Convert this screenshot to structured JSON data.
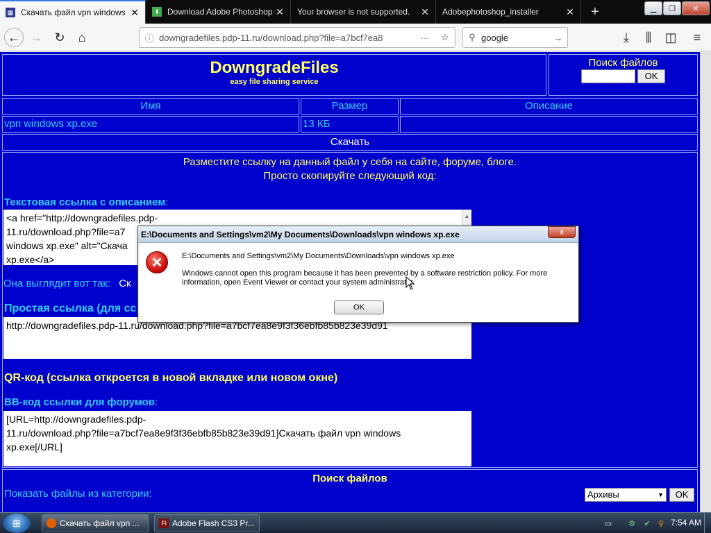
{
  "browser": {
    "tabs": [
      {
        "title": "Скачать файл vpn windows",
        "active": true,
        "icon": "site-favicon"
      },
      {
        "title": "Download Adobe Photoshop",
        "active": false,
        "icon": "green-download-favicon"
      },
      {
        "title": "Your browser is not supported.",
        "active": false,
        "icon": ""
      },
      {
        "title": "Adobephotoshop_installer",
        "active": false,
        "icon": ""
      }
    ],
    "new_tab": "+",
    "url": "downgradefiles.pdp-11.ru/download.php?file=a7bcf7ea8",
    "search_value": "google"
  },
  "site": {
    "logo_title": "DowngradeFiles",
    "logo_subtitle": "easy file sharing service",
    "search_label": "Поиск файлов",
    "search_ok": "OK",
    "table_headers": [
      "Имя",
      "Размер",
      "Описание"
    ],
    "file_name": "vpn windows xp.exe",
    "file_size": "13 КБ",
    "file_desc": "",
    "download_label": "Скачать",
    "share_line1": "Разместите ссылку на данный файл у себя на сайте, форуме, блоге.",
    "share_line2": "Просто скопируйте следующий код:",
    "text_link_label": "Текстовая ссылка с описанием",
    "text_link_colon": ":",
    "text_link_code": "<a href=\"http://downgradefiles.pdp-11.ru/download.php?file=a7... windows xp.exe\" alt=\"Скача... xp.exe</a>",
    "text_link_line1": "<a href=\"http://downgradefiles.pdp-",
    "text_link_line2": "11.ru/download.php?file=a7",
    "text_link_line3": "windows xp.exe\" alt=\"Скача",
    "text_link_line4": "xp.exe</a>",
    "preview_label": "Она выглядит вот так:",
    "preview_value": "Ск",
    "simple_link_label": "Простая ссылка (для сс",
    "simple_link_code": "http://downgradefiles.pdp-11.ru/download.php?file=a7bcf7ea8e9f3f36ebfb85b823e39d91",
    "qr_label": "QR-код (ссылка откроется в новой вкладке или новом окне)",
    "bb_label": "BB-код ссылки для форумов",
    "bb_colon": ":",
    "bb_line1": "[URL=http://downgradefiles.pdp-",
    "bb_line2": "11.ru/download.php?file=a7bcf7ea8e9f3f36ebfb85b823e39d91]Скачать файл vpn windows",
    "bb_line3": "xp.exe[/URL]",
    "search_section_title": "Поиск файлов",
    "category_label": "Показать файлы из категории:",
    "category_selected": "Архивы",
    "category_ok": "OK"
  },
  "dialog": {
    "title": "E:\\Documents and Settings\\vm2\\My Documents\\Downloads\\vpn windows xp.exe",
    "close": "x",
    "path": "E:\\Documents and Settings\\vm2\\My Documents\\Downloads\\vpn windows xp.exe",
    "message": "Windows cannot open this program because it has been prevented by a software restriction policy. For more information, open Event Viewer or contact your system administrator.",
    "ok": "OK",
    "icon": "error-icon"
  },
  "taskbar": {
    "items": [
      {
        "label": "Скачать файл vpn ...",
        "icon": "firefox-icon"
      },
      {
        "label": "Adobe Flash CS3 Pr...",
        "icon": "flash-icon"
      }
    ],
    "time": "7:54 AM"
  },
  "colors": {
    "page_bg": "#0000cc",
    "heading_yellow": "#ffff66",
    "label_cyan": "#33ccff",
    "tab_active_accent": "#2f7de1"
  }
}
